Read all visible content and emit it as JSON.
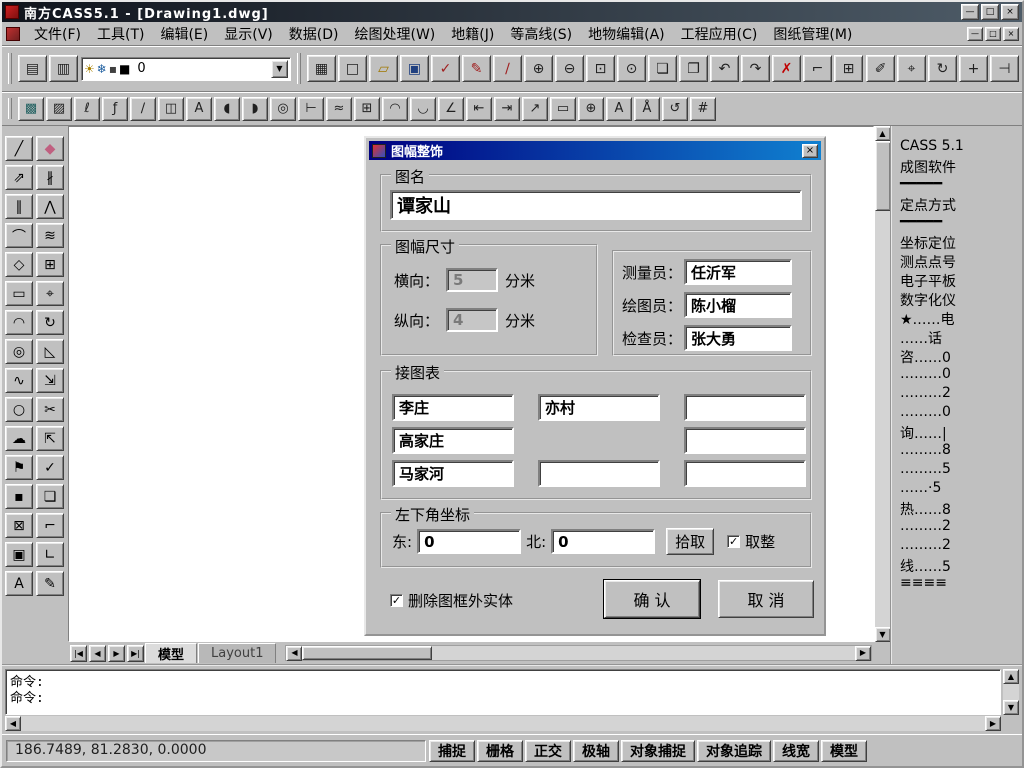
{
  "window": {
    "title": "南方CASS5.1 - [Drawing1.dwg]",
    "controls": {
      "minimize": "—",
      "restore": "□",
      "close": "×"
    },
    "child_controls": {
      "minimize": "—",
      "restore": "□",
      "close": "×"
    }
  },
  "menubar": {
    "items": [
      "文件(F)",
      "工具(T)",
      "编辑(E)",
      "显示(V)",
      "数据(D)",
      "绘图处理(W)",
      "地籍(J)",
      "等高线(S)",
      "地物编辑(A)",
      "工程应用(C)",
      "图纸管理(M)"
    ]
  },
  "glyphs": {
    "up": "▲",
    "down": "▼",
    "left": "◀",
    "right": "▶"
  },
  "toolbar1": {
    "left_icons": [
      {
        "name": "layer-dialog-icon",
        "glyph": "▤"
      },
      {
        "name": "layer-list-icon",
        "glyph": "▥"
      }
    ],
    "combo": {
      "icons": [
        {
          "name": "bulb-icon",
          "glyph": "☀",
          "color": "#a88000"
        },
        {
          "name": "freeze-icon",
          "glyph": "❄",
          "color": "#2060a0"
        },
        {
          "name": "lock-icon",
          "glyph": "▪",
          "color": "#404040"
        },
        {
          "name": "color-swatch-icon",
          "glyph": "■",
          "color": "#000000"
        }
      ],
      "value": "0",
      "arrow": "▼"
    },
    "icons": [
      {
        "name": "linetype-icon",
        "glyph": "▦"
      },
      {
        "name": "new-file-icon",
        "glyph": "□"
      },
      {
        "name": "open-file-icon",
        "glyph": "▱",
        "color": "#a07800"
      },
      {
        "name": "save-file-icon",
        "glyph": "▣",
        "color": "#204080"
      },
      {
        "name": "spell-check-icon",
        "glyph": "✓",
        "color": "#a02020"
      },
      {
        "name": "redline-pencil-icon",
        "glyph": "✎",
        "color": "#a02020"
      },
      {
        "name": "match-prop-icon",
        "glyph": "∕",
        "color": "#a02020"
      },
      {
        "name": "zoom-in-icon",
        "glyph": "⊕"
      },
      {
        "name": "zoom-out-icon",
        "glyph": "⊖"
      },
      {
        "name": "zoom-window-icon",
        "glyph": "⊡"
      },
      {
        "name": "zoom-extents-icon",
        "glyph": "⊙"
      },
      {
        "name": "copy-icon",
        "glyph": "❏"
      },
      {
        "name": "paste-icon",
        "glyph": "❐"
      },
      {
        "name": "undo-icon",
        "glyph": "↶"
      },
      {
        "name": "redo-icon",
        "glyph": "↷"
      },
      {
        "name": "cancel-icon",
        "glyph": "✗",
        "color": "#c00000"
      },
      {
        "name": "ucs-icon",
        "glyph": "⌐"
      },
      {
        "name": "table-icon",
        "glyph": "⊞"
      }
    ],
    "right_icons": [
      {
        "name": "sketch-pen-icon",
        "glyph": "✐"
      },
      {
        "name": "move-point-icon",
        "glyph": "⌖"
      },
      {
        "name": "rotate-view-icon",
        "glyph": "↻"
      },
      {
        "name": "snap-point-icon",
        "glyph": "+"
      },
      {
        "name": "break-line-icon",
        "glyph": "⊣"
      }
    ]
  },
  "toolbar2": {
    "icons": [
      {
        "name": "solid-fill-icon",
        "glyph": "▩",
        "color": "#206060"
      },
      {
        "name": "hatch-icon",
        "glyph": "▨"
      },
      {
        "name": "pline-pen-icon",
        "glyph": "ℓ"
      },
      {
        "name": "spline-pen-icon",
        "glyph": "ƒ"
      },
      {
        "name": "line-slash-icon",
        "glyph": "∕"
      },
      {
        "name": "wipeout-icon",
        "glyph": "◫"
      },
      {
        "name": "text-style-icon",
        "glyph": "A"
      },
      {
        "name": "ellipse-left-icon",
        "glyph": "◖"
      },
      {
        "name": "ellipse-right-icon",
        "glyph": "◗"
      },
      {
        "name": "circle-mark-icon",
        "glyph": "◎"
      },
      {
        "name": "dim-linear-icon",
        "glyph": "⊢"
      },
      {
        "name": "dim-curve-icon",
        "glyph": "≈"
      },
      {
        "name": "grid-points-icon",
        "glyph": "⊞"
      },
      {
        "name": "arc-up-icon",
        "glyph": "◠"
      },
      {
        "name": "arc-down-icon",
        "glyph": "◡"
      },
      {
        "name": "angle-dim-icon",
        "glyph": "∠"
      },
      {
        "name": "dim-left-icon",
        "glyph": "⇤"
      },
      {
        "name": "dim-right-icon",
        "glyph": "⇥"
      },
      {
        "name": "leader-icon",
        "glyph": "↗"
      },
      {
        "name": "rect-dim-icon",
        "glyph": "▭"
      },
      {
        "name": "center-mark-icon",
        "glyph": "⊕"
      },
      {
        "name": "text-add-icon",
        "glyph": "A"
      },
      {
        "name": "text-angle-icon",
        "glyph": "Å"
      },
      {
        "name": "rotate-grid-icon",
        "glyph": "↺"
      },
      {
        "name": "hash-grid-icon",
        "glyph": "#"
      }
    ]
  },
  "palette": {
    "items": [
      {
        "name": "draw-line-icon",
        "glyph": "╱"
      },
      {
        "name": "erase-icon",
        "glyph": "◆",
        "color": "#c06080"
      },
      {
        "name": "draw-ray-icon",
        "glyph": "⇗"
      },
      {
        "name": "break-icon",
        "glyph": "∦"
      },
      {
        "name": "draw-parallel-icon",
        "glyph": "∥"
      },
      {
        "name": "mirror-icon",
        "glyph": "⋀"
      },
      {
        "name": "draw-curve-icon",
        "glyph": "⌒"
      },
      {
        "name": "offset-icon",
        "glyph": "≋"
      },
      {
        "name": "draw-polygon-icon",
        "glyph": "◇"
      },
      {
        "name": "array-icon",
        "glyph": "⊞"
      },
      {
        "name": "draw-rect-icon",
        "glyph": "▭"
      },
      {
        "name": "move-icon",
        "glyph": "⌖"
      },
      {
        "name": "draw-arc-icon",
        "glyph": "◠"
      },
      {
        "name": "rotate-icon",
        "glyph": "↻"
      },
      {
        "name": "draw-circle-icon",
        "glyph": "◎"
      },
      {
        "name": "scale-icon",
        "glyph": "◺"
      },
      {
        "name": "draw-spline-icon",
        "glyph": "∿"
      },
      {
        "name": "stretch-icon",
        "glyph": "⇲"
      },
      {
        "name": "draw-ellipse-icon",
        "glyph": "○"
      },
      {
        "name": "trim-icon",
        "glyph": "✂"
      },
      {
        "name": "draw-cloud-icon",
        "glyph": "☁"
      },
      {
        "name": "extend-icon",
        "glyph": "⇱"
      },
      {
        "name": "draw-flag-icon",
        "glyph": "⚑"
      },
      {
        "name": "edit-vertex-icon",
        "glyph": "✓"
      },
      {
        "name": "draw-point-icon",
        "glyph": "▪"
      },
      {
        "name": "copy-object-icon",
        "glyph": "❏"
      },
      {
        "name": "hatch-fill-icon",
        "glyph": "⊠"
      },
      {
        "name": "fillet-icon",
        "glyph": "⌐"
      },
      {
        "name": "insert-image-icon",
        "glyph": "▣"
      },
      {
        "name": "chamfer-icon",
        "glyph": "∟"
      },
      {
        "name": "draw-text-icon",
        "glyph": "A"
      },
      {
        "name": "sketch-icon",
        "glyph": "✎"
      }
    ]
  },
  "right_panel": {
    "lines": [
      "CASS 5.1",
      "成图软件",
      "━━━━━",
      "定点方式",
      "━━━━━",
      "坐标定位",
      "测点点号",
      "电子平板",
      "数字化仪",
      "★……电",
      "……话",
      "咨……0",
      "………0",
      "………2",
      "………0",
      "询……|",
      "………8",
      "………5",
      "……·5",
      "热……8",
      "………2",
      "………2",
      "线……5",
      "≡≡≡≡"
    ]
  },
  "dialog": {
    "title": "图幅整饰",
    "close_glyph": "×",
    "check_glyph": "✓",
    "name_group": {
      "label": "图名",
      "value": "谭家山"
    },
    "size_group": {
      "label": "图幅尺寸",
      "h_label": "横向：",
      "h_value": "5",
      "h_unit": "分米",
      "v_label": "纵向：",
      "v_value": "4",
      "v_unit": "分米"
    },
    "staff_group": {
      "rows": [
        {
          "label": "测量员：",
          "value": "任沂军"
        },
        {
          "label": "绘图员：",
          "value": "陈小榴"
        },
        {
          "label": "检查员：",
          "value": "张大勇"
        }
      ]
    },
    "adjoin_group": {
      "label": "接图表",
      "cells": [
        "李庄",
        "亦村",
        "",
        "高家庄",
        null,
        "",
        "马家河",
        "",
        ""
      ]
    },
    "corner_group": {
      "label": "左下角坐标",
      "east_label": "东:",
      "east_value": "0",
      "north_label": "北:",
      "north_value": "0",
      "pick_label": "拾取",
      "round_label": "取整"
    },
    "delete_label": "删除图框外实体",
    "ok_label": "确  认",
    "cancel_label": "取  消"
  },
  "tabs": {
    "model": "模型",
    "layout1": "Layout1",
    "nav": [
      {
        "name": "tab-first-button",
        "glyph": "|◀"
      },
      {
        "name": "tab-prev-button",
        "glyph": "◀"
      },
      {
        "name": "tab-next-button",
        "glyph": "▶"
      },
      {
        "name": "tab-last-button",
        "glyph": "▶|"
      }
    ]
  },
  "command": {
    "lines": [
      "命令:",
      "命令:"
    ]
  },
  "statusbar": {
    "coordinates": "186.7489, 81.2830, 0.0000",
    "buttons": [
      {
        "name": "snap-toggle",
        "label": "捕捉"
      },
      {
        "name": "grid-toggle",
        "label": "栅格"
      },
      {
        "name": "ortho-toggle",
        "label": "正交"
      },
      {
        "name": "polar-toggle",
        "label": "极轴"
      },
      {
        "name": "osnap-toggle",
        "label": "对象捕捉"
      },
      {
        "name": "otrack-toggle",
        "label": "对象追踪"
      },
      {
        "name": "lineweight-toggle",
        "label": "线宽"
      },
      {
        "name": "model-toggle",
        "label": "模型"
      }
    ]
  }
}
